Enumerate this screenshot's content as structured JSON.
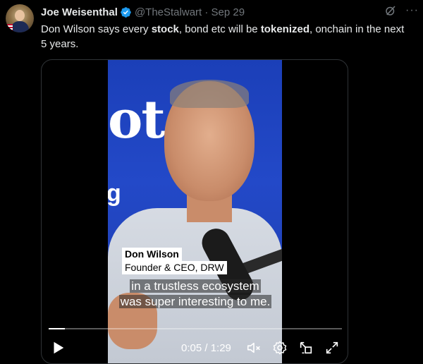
{
  "tweet": {
    "author_name": "Joe Weisenthal",
    "handle_date": "@TheStalwart · Sep 29",
    "text_parts": [
      {
        "t": "Don Wilson says every ",
        "b": false
      },
      {
        "t": "stock",
        "b": true
      },
      {
        "t": ", bond etc will be ",
        "b": false
      },
      {
        "t": "tokenized",
        "b": true
      },
      {
        "t": ", onchain in the next 5 years.",
        "b": false
      }
    ],
    "more_icon": "···"
  },
  "video": {
    "background_text": "ot",
    "background_letter": "g",
    "lower_third": {
      "name": "Don Wilson",
      "title": "Founder & CEO, DRW"
    },
    "captions": [
      "in a trustless ecosystem",
      "was super interesting to me."
    ],
    "time": "0:05 / 1:29",
    "progress": 0.056,
    "icons": [
      "play-icon",
      "mute-icon",
      "settings-icon",
      "pop-out-icon",
      "fullscreen-icon"
    ]
  },
  "colors": {
    "background": "#000000",
    "text_primary": "#e7e9ea",
    "text_secondary": "#71767b",
    "verified": "#1d9bf0",
    "video_blue": "#2349c8"
  }
}
